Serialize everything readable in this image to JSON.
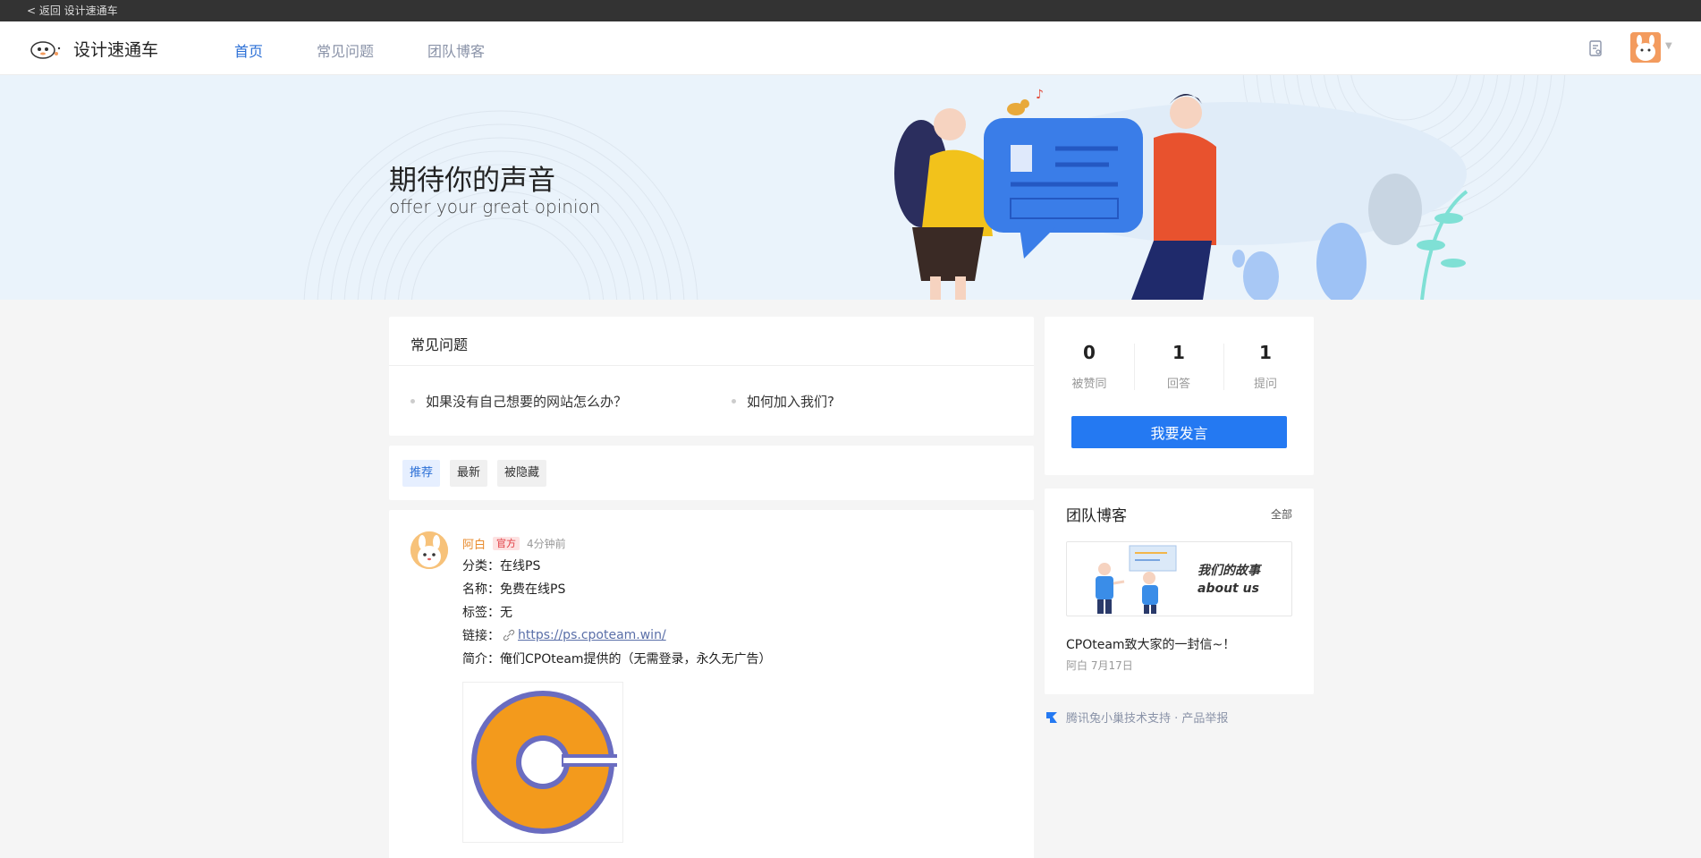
{
  "topbar": {
    "back_label": "< 返回 设计速通车"
  },
  "nav": {
    "site_name": "设计速通车",
    "links": [
      {
        "label": "首页",
        "active": true
      },
      {
        "label": "常见问题",
        "active": false
      },
      {
        "label": "团队博客",
        "active": false
      }
    ]
  },
  "banner": {
    "title": "期待你的声音",
    "subtitle": "offer your great opinion"
  },
  "faq": {
    "title": "常见问题",
    "items": [
      "如果没有自己想要的网站怎么办？",
      "如何加入我们?"
    ]
  },
  "tabs": [
    {
      "label": "推荐",
      "active": true
    },
    {
      "label": "最新",
      "active": false
    },
    {
      "label": "被隐藏",
      "active": false
    }
  ],
  "post": {
    "author": "阿白",
    "badge": "官方",
    "time": "4分钟前",
    "category": "分类：在线PS",
    "name": "名称：免费在线PS",
    "tags": "标签：无",
    "link_prefix": "链接：",
    "link_url": "https://ps.cpoteam.win/",
    "intro": "简介：俺们CPOteam提供的（无需登录，永久无广告）"
  },
  "stats": [
    {
      "value": "0",
      "label": "被赞同"
    },
    {
      "value": "1",
      "label": "回答"
    },
    {
      "value": "1",
      "label": "提问"
    }
  ],
  "speak_button": "我要发言",
  "blog": {
    "title": "团队博客",
    "all_label": "全部",
    "thumb_line1": "我们的故事",
    "thumb_line2": "about us",
    "post_title": "CPOteam致大家的一封信~！",
    "post_meta": "阿白 7月17日"
  },
  "footer": {
    "label": "腾讯兔小巢技术支持 · 产品举报"
  },
  "colors": {
    "accent": "#2479f2",
    "nav_active": "#2b6fd6",
    "author": "#e88a2c"
  }
}
